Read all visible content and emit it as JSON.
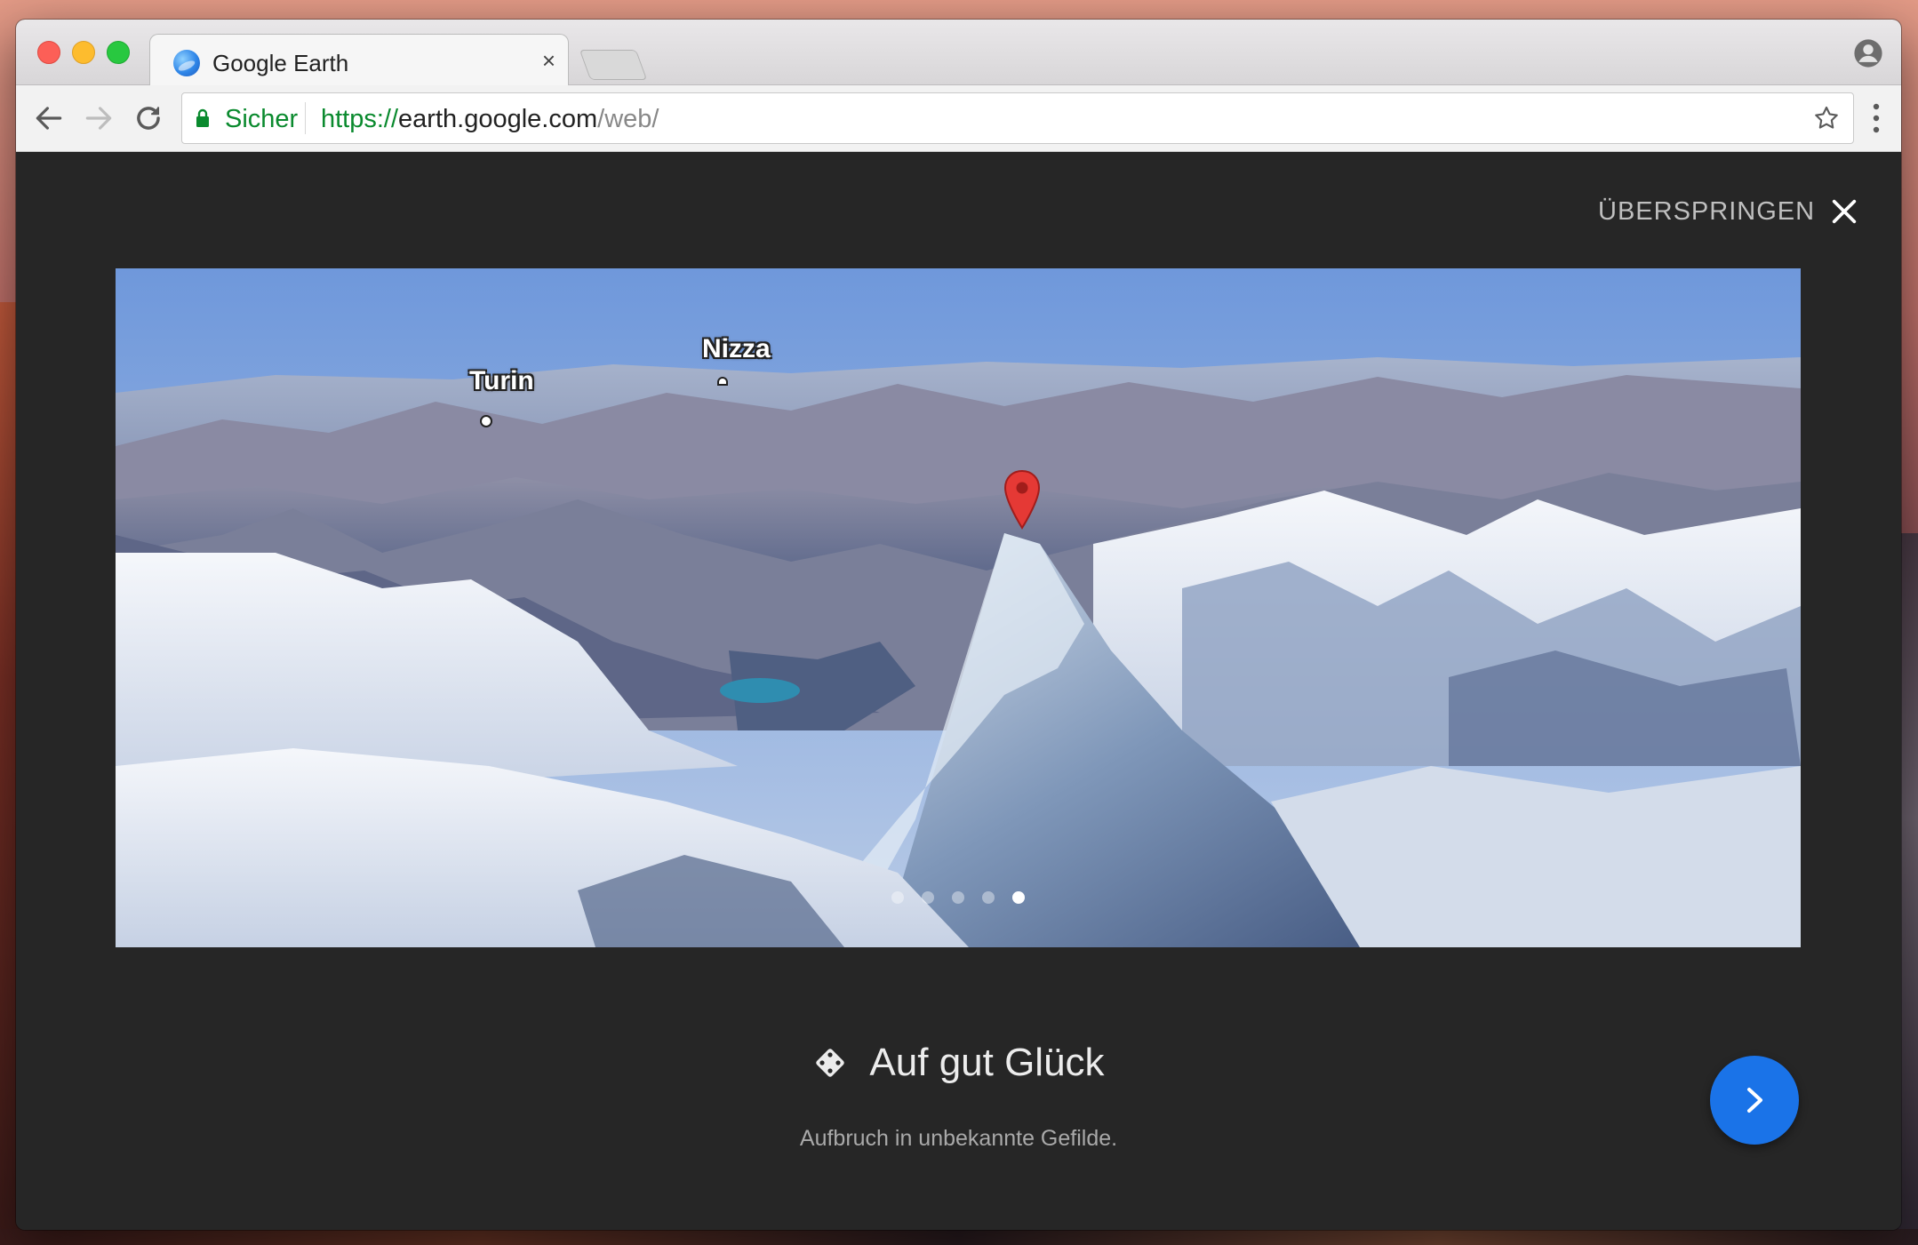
{
  "browser": {
    "tab_title": "Google Earth",
    "tab_close": "×",
    "secure_label": "Sicher",
    "url_scheme": "https://",
    "url_host": "earth.google.com",
    "url_path": "/web/"
  },
  "onboarding": {
    "skip_label": "ÜBERSPRINGEN",
    "places": [
      {
        "name": "Turin"
      },
      {
        "name": "Nizza"
      }
    ],
    "slide_count": 5,
    "active_slide": 5,
    "title": "Auf gut Glück",
    "subtitle": "Aufbruch in unbekannte Gefilde."
  },
  "colors": {
    "accent_blue": "#1a73e8",
    "secure_green": "#0a8a2e",
    "background_dark": "#262626",
    "pin_red": "#e53935"
  },
  "icons": [
    "back-arrow-icon",
    "forward-arrow-icon",
    "reload-icon",
    "lock-icon",
    "star-icon",
    "menu-icon",
    "profile-icon",
    "close-icon",
    "dice-icon",
    "chevron-right-icon",
    "map-pin-icon"
  ]
}
